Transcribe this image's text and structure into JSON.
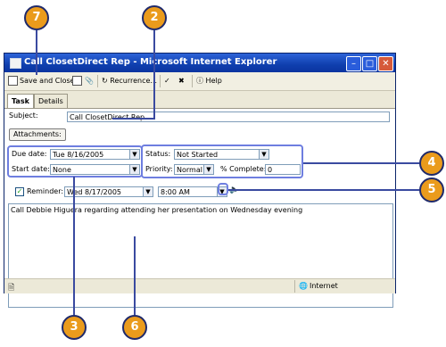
{
  "window": {
    "title": "Call ClosetDirect Rep - Microsoft Internet Explorer",
    "controls": [
      "minimize",
      "maximize",
      "close"
    ]
  },
  "toolbar": {
    "save_close_label": "Save and Close",
    "recurrence_label": "Recurrence...",
    "help_label": "Help"
  },
  "tabs": [
    {
      "label": "Task"
    },
    {
      "label": "Details"
    }
  ],
  "form": {
    "subject_label": "Subject:",
    "subject_value": "Call ClosetDirect Rep",
    "attachments_label": "Attachments:",
    "due_date_label": "Due date:",
    "due_date_value": "Tue 8/16/2005",
    "start_date_label": "Start date:",
    "start_date_value": "None",
    "status_label": "Status:",
    "status_value": "Not Started",
    "priority_label": "Priority:",
    "priority_value": "Normal",
    "percent_label": "% Complete:",
    "percent_value": "0",
    "reminder_label": "Reminder:",
    "reminder_checked": true,
    "reminder_date": "Wed 8/17/2005",
    "reminder_time": "8:00 AM",
    "notes": "Call Debbie Higuera regarding attending her presentation on Wednesday evening"
  },
  "statusbar": {
    "zone_label": "Internet"
  },
  "callouts": [
    "7",
    "2",
    "4",
    "5",
    "3",
    "6"
  ],
  "colors": {
    "callout_fill": "#ea9b1c",
    "highlight_border": "#6e7ee0",
    "titlebar": "#0f3fae"
  }
}
